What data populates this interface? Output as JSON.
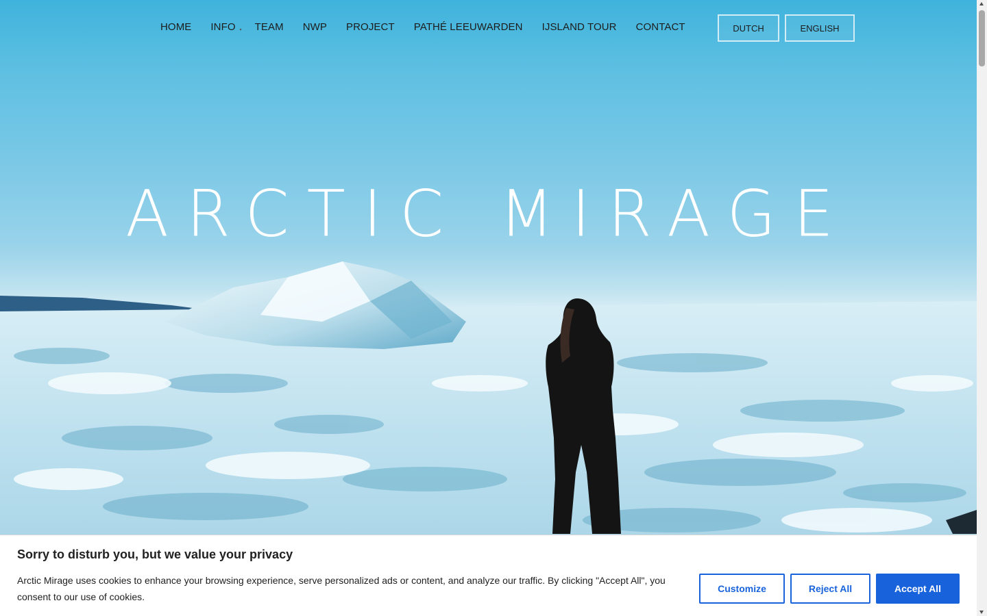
{
  "nav": {
    "items": [
      {
        "label": "HOME"
      },
      {
        "label": "INFO",
        "has_submenu": true
      },
      {
        "label": "TEAM"
      },
      {
        "label": "NWP"
      },
      {
        "label": "PROJECT"
      },
      {
        "label": "PATHÉ LEEUWARDEN"
      },
      {
        "label": "IJSLAND TOUR"
      },
      {
        "label": "CONTACT"
      }
    ],
    "languages": {
      "dutch": "DUTCH",
      "english": "ENGLISH"
    }
  },
  "hero": {
    "title": "ARCTIC MIRAGE"
  },
  "cookie": {
    "title": "Sorry to disturb you, but we value your privacy",
    "text": "Arctic Mirage uses cookies to enhance your browsing experience, serve personalized ads or content, and analyze our traffic. By clicking \"Accept All\", you consent to our use of cookies.",
    "customize": "Customize",
    "reject": "Reject All",
    "accept": "Accept All",
    "accent_color": "#1863dc"
  }
}
